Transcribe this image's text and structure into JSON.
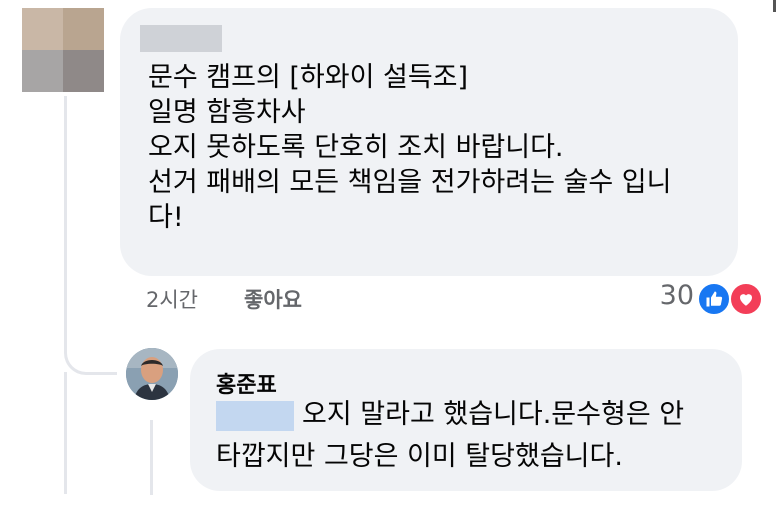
{
  "comment": {
    "author_redacted": true,
    "lines": [
      "문수 캠프의 [하와이 설득조]",
      "일명 함흥차사",
      "오지 못하도록 단호히 조치 바랍니다.",
      "선거 패배의 모든 책임을 전가하려는 술수 입니",
      "다!"
    ],
    "time": "2시간",
    "like_label": "좋아요",
    "reaction_count": "30",
    "reaction_icons": [
      "like-icon",
      "love-icon"
    ]
  },
  "reply": {
    "author": "홍준표",
    "mention_redacted": true,
    "line1": "오지 말라고 했습니다.문수형은 안",
    "line2": "타깝지만 그당은 이미 탈당했습니다."
  },
  "colors": {
    "bubble": "#f0f2f5",
    "meta_text": "#65676b",
    "like_blue": "#1877f2",
    "love_red": "#f33e58"
  }
}
